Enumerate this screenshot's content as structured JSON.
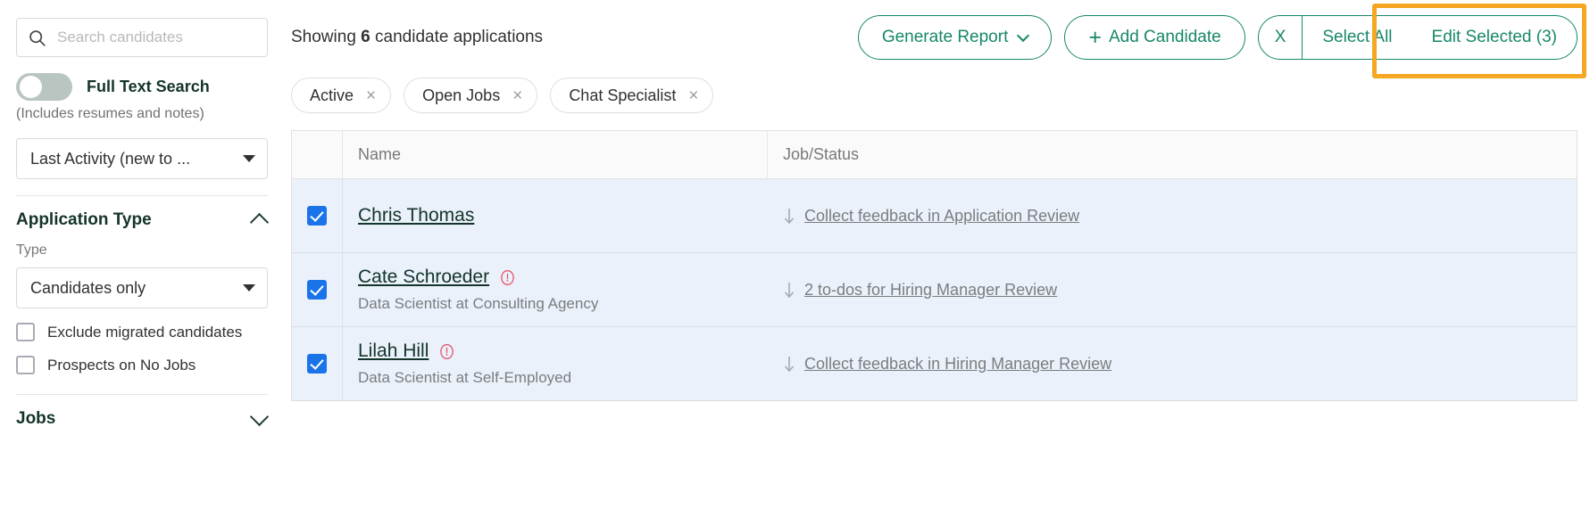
{
  "colors": {
    "brand_green": "#16876a",
    "dark_green": "#14342a",
    "highlight_orange": "#f5a623",
    "checkbox_blue": "#1a73e8",
    "row_selected_bg": "#eaf1fa",
    "alert_red": "#e8576f"
  },
  "sidebar": {
    "search": {
      "placeholder": "Search candidates",
      "value": "",
      "icon": "search-icon"
    },
    "full_text_search": {
      "label": "Full Text Search",
      "sublabel": "(Includes resumes and notes)",
      "enabled": false
    },
    "sort_select": {
      "value": "Last Activity (new to ...",
      "icon": "caret-down-icon"
    },
    "sections": [
      {
        "title": "Application Type",
        "expanded": true,
        "chevron": "chevron-up-icon",
        "field_label": "Type",
        "select_value": "Candidates only",
        "checkboxes": [
          {
            "label": "Exclude migrated candidates",
            "checked": false
          },
          {
            "label": "Prospects on No Jobs",
            "checked": false
          }
        ]
      },
      {
        "title": "Jobs",
        "expanded": false,
        "chevron": "chevron-down-icon"
      }
    ]
  },
  "topbar": {
    "showing_prefix": "Showing",
    "showing_count": "6",
    "showing_suffix": "candidate applications",
    "generate_report_label": "Generate Report",
    "generate_report_chevron": "chevron-down-icon",
    "add_candidate_label": "Add Candidate",
    "add_candidate_plus": "+",
    "clear_label": "X",
    "select_all_label": "Select All",
    "edit_selected_label": "Edit Selected (3)"
  },
  "filter_chips": [
    {
      "label": "Active",
      "remove": "×"
    },
    {
      "label": "Open Jobs",
      "remove": "×"
    },
    {
      "label": "Chat Specialist",
      "remove": "×"
    }
  ],
  "table": {
    "columns": [
      "",
      "Name",
      "Job/Status"
    ],
    "rows": [
      {
        "selected": true,
        "name": "Chris Thomas",
        "has_alert": false,
        "subtitle": "",
        "status": "Collect feedback in Application Review",
        "status_icon": "down-arrow-icon"
      },
      {
        "selected": true,
        "name": "Cate Schroeder",
        "has_alert": true,
        "subtitle": "Data Scientist at Consulting Agency",
        "status": "2 to-dos for Hiring Manager Review",
        "status_icon": "down-arrow-icon"
      },
      {
        "selected": true,
        "name": "Lilah Hill",
        "has_alert": true,
        "subtitle": "Data Scientist at Self-Employed",
        "status": "Collect feedback in Hiring Manager Review",
        "status_icon": "down-arrow-icon"
      }
    ]
  }
}
